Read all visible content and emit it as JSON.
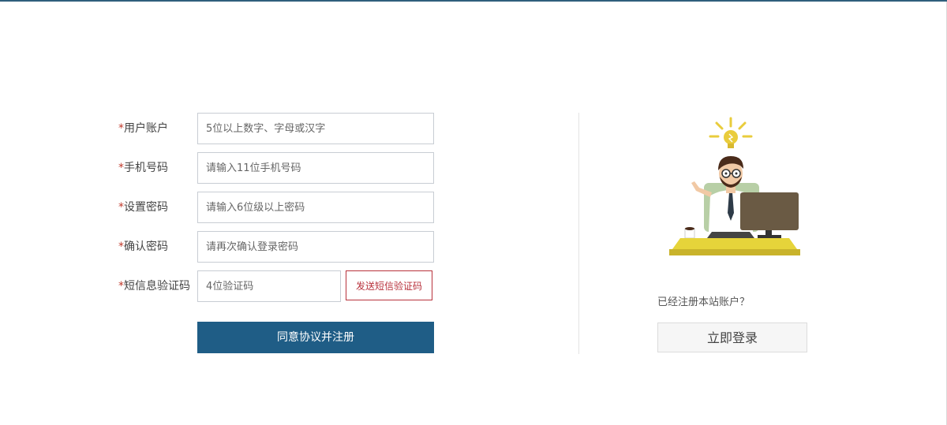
{
  "form": {
    "fields": [
      {
        "required_mark": "*",
        "label": "用户账户",
        "placeholder": "5位以上数字、字母或汉字"
      },
      {
        "required_mark": "*",
        "label": "手机号码",
        "placeholder": "请输入11位手机号码"
      },
      {
        "required_mark": "*",
        "label": "设置密码",
        "placeholder": "请输入6位级以上密码"
      },
      {
        "required_mark": "*",
        "label": "确认密码",
        "placeholder": "请再次确认登录密码"
      },
      {
        "required_mark": "*",
        "label": "短信息验证码",
        "placeholder": "4位验证码"
      }
    ],
    "sms_button_label": "发送短信验证码",
    "submit_label": "同意协议并注册"
  },
  "side": {
    "illustration_icon": "businessman-at-computer-with-lightbulb-icon",
    "login_prompt": "已经注册本站账户？",
    "login_button_label": "立即登录"
  },
  "colors": {
    "top_bar": "#2f5f7c",
    "primary_button": "#1f5d86",
    "sms_button": "#b8323c",
    "required_mark": "#c0392b"
  }
}
